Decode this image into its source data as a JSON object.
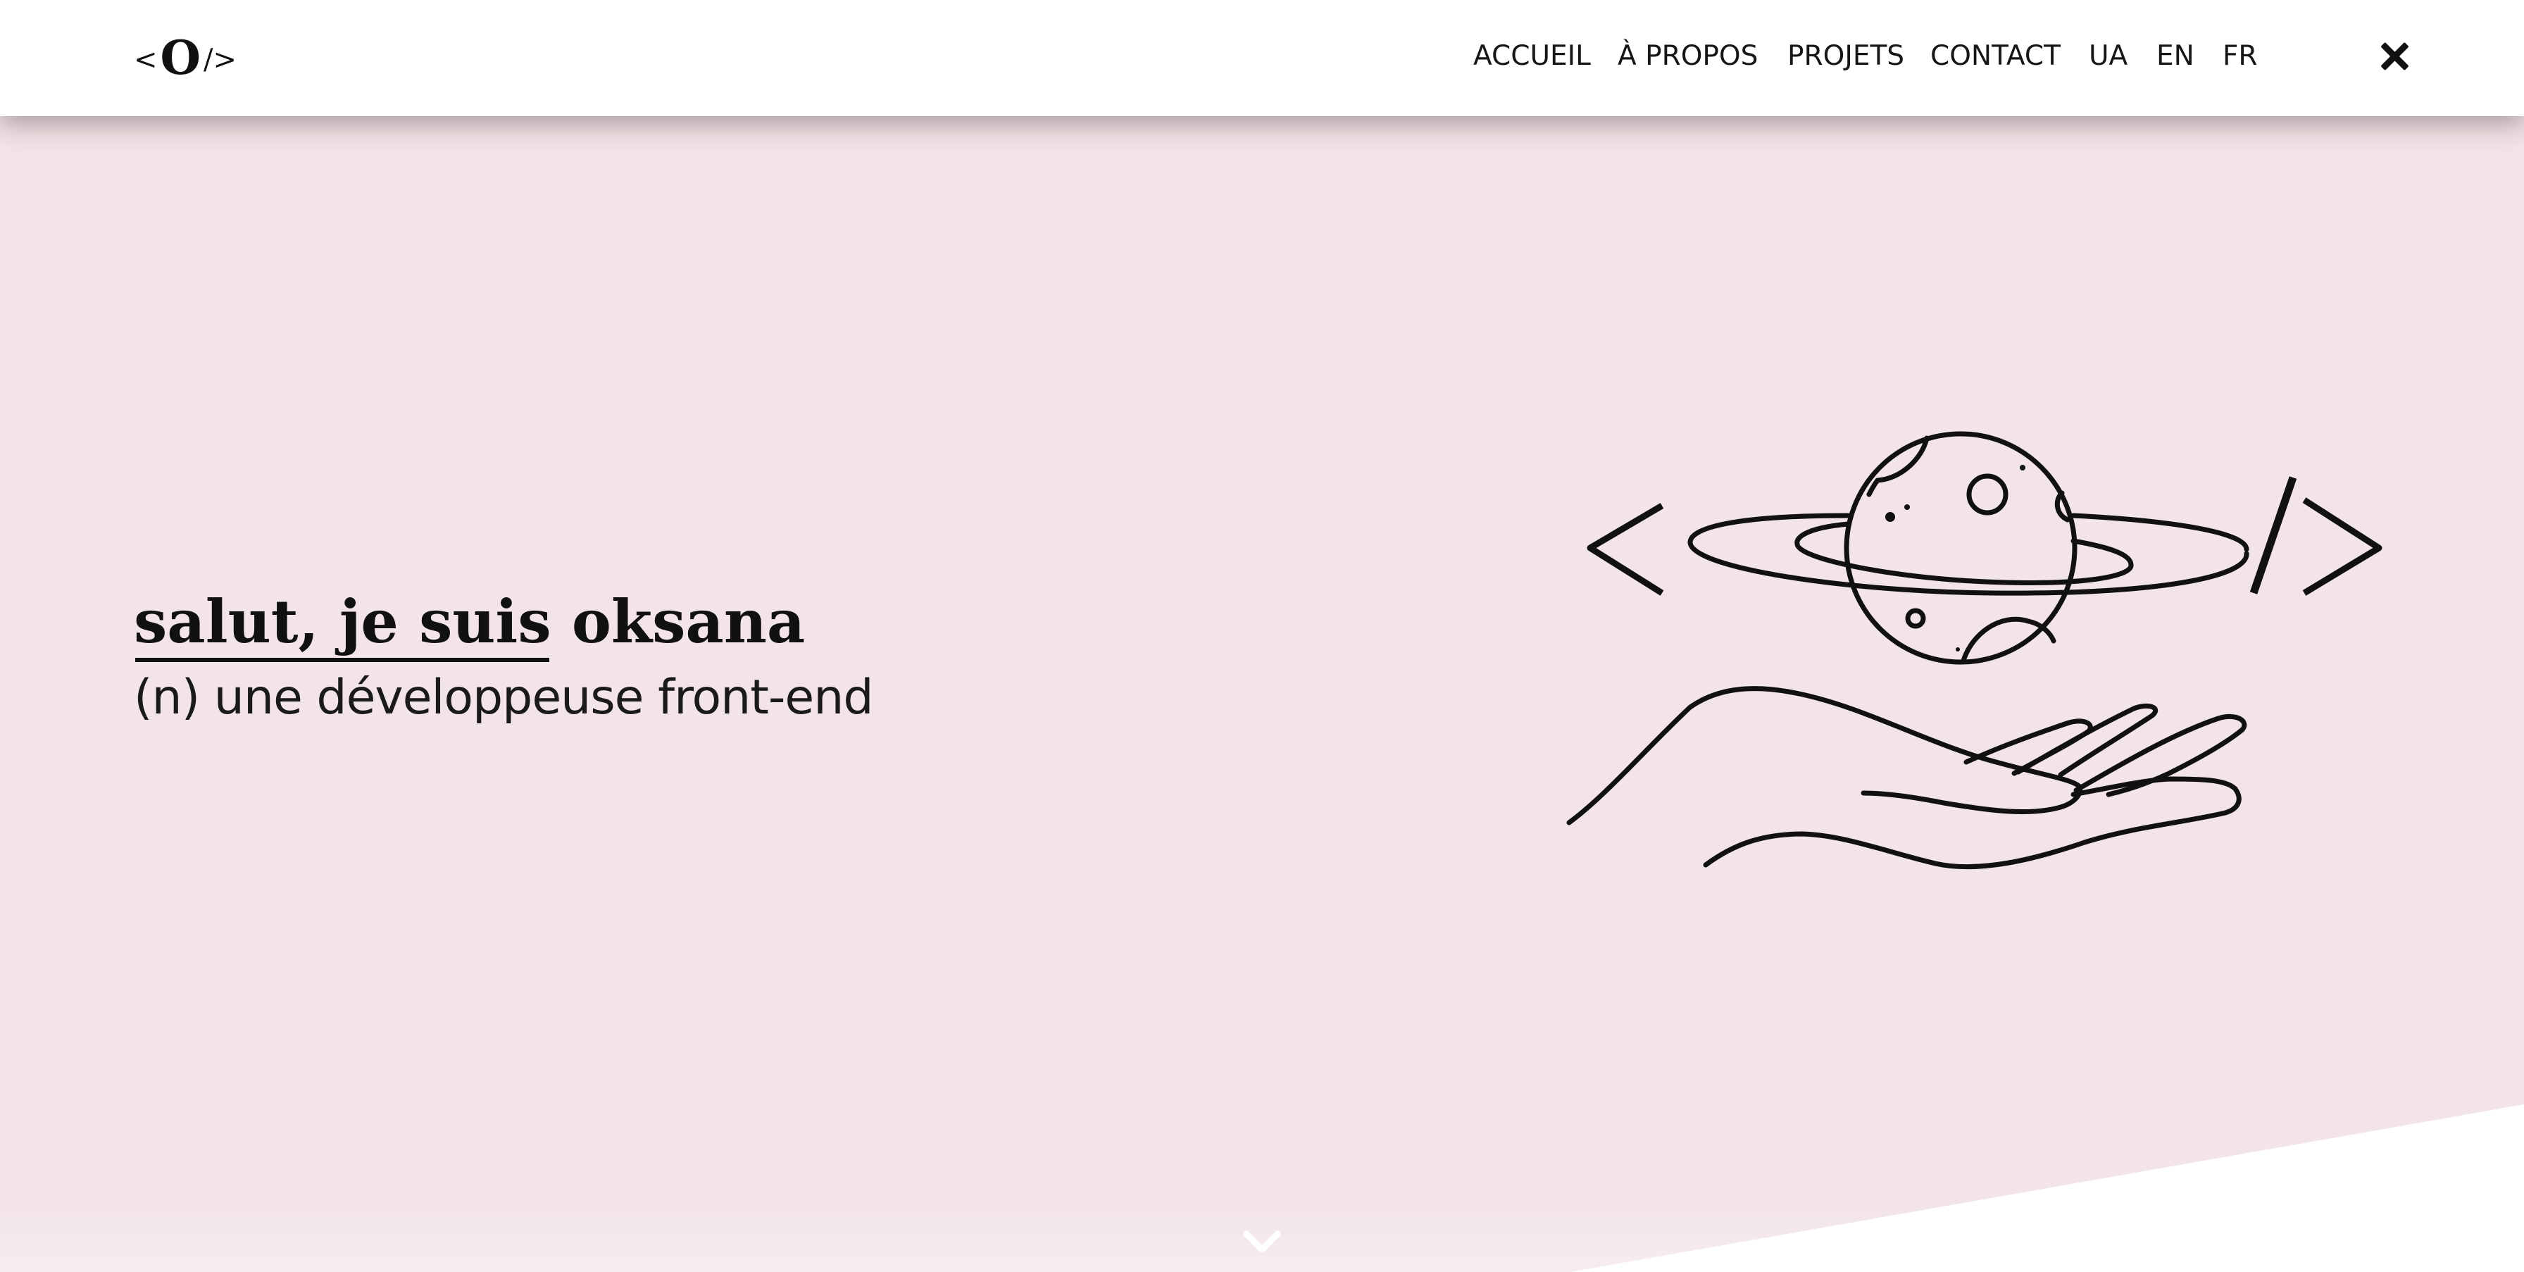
{
  "header": {
    "logo": {
      "left": "<",
      "mark": "O",
      "right": "/>"
    },
    "nav": [
      {
        "label": "ACCUEIL"
      },
      {
        "label": "À PROPOS"
      },
      {
        "label": "PROJETS"
      },
      {
        "label": "CONTACT"
      },
      {
        "label": "UA"
      },
      {
        "label": "EN"
      },
      {
        "label": "FR"
      }
    ],
    "close_icon": "close-icon"
  },
  "hero": {
    "title": "salut, je suis oksana",
    "subtitle": "(n) une développeuse front-end",
    "illustration_icon": "planet-in-hand-code-icon",
    "scroll_icon": "chevron-down-icon"
  },
  "colors": {
    "background": "#f2e4e7",
    "header": "#ffffff",
    "ink": "#111111",
    "accent_white": "#ffffff"
  }
}
